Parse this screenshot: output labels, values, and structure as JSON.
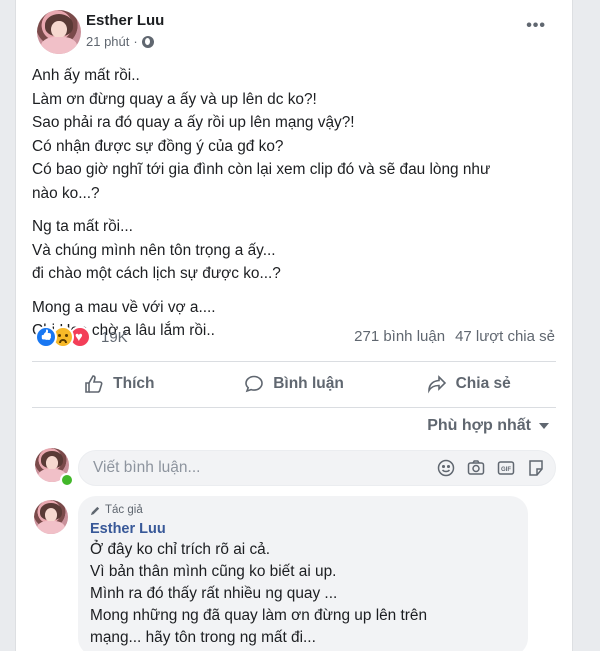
{
  "post": {
    "author": "Esther Luu",
    "time": "21 phút",
    "dot": "·",
    "more_label": "•••",
    "paragraphs": [
      [
        "Anh ấy mất rồi..",
        "Làm ơn đừng quay a ấy và up lên dc ko?!",
        "Sao phải ra đó quay a ấy rồi up lên mạng vậy?!",
        "Có nhận được sự đồng ý của gđ ko?",
        "Có bao giờ nghĩ tới gia đình còn lại xem clip đó và sẽ đau lòng như",
        "nào ko...?"
      ],
      [
        "Ng ta mất rồi...",
        "Và chúng mình nên tôn trọng a ấy...",
        "đi chào một cách lịch sự được ko...?"
      ],
      [
        "Mong a mau về với vợ a....",
        "Chị Heo chờ a lâu lắm rồi.."
      ]
    ]
  },
  "stats": {
    "reaction_count": "19K",
    "comments": "271 bình luận",
    "shares": "47 lượt chia sẻ"
  },
  "actions": {
    "like": "Thích",
    "comment": "Bình luận",
    "share": "Chia sẻ"
  },
  "sort": {
    "label": "Phù hợp nhất"
  },
  "composer": {
    "placeholder": "Viết bình luận..."
  },
  "comment": {
    "badge": "Tác giả",
    "author": "Esther Luu",
    "lines": [
      "Ở đây ko chỉ trích rõ ai cả.",
      "Vì bản thân mình cũng ko biết ai up.",
      "Mình ra đó thấy rất nhiều ng quay ...",
      "Mong những ng đã quay làm ơn đừng up lên trên",
      "mạng... hãy tôn trong ng mất đi..."
    ]
  },
  "colors": {
    "like_blue": "#1877f2",
    "sad_yellow": "#f7b928",
    "love_red": "#f33e58",
    "online_green": "#42b72a",
    "author_link": "#385898"
  },
  "icons": {
    "reactions": [
      "like-reaction-icon",
      "sad-reaction-icon",
      "love-reaction-icon"
    ],
    "composer": [
      "emoji-icon",
      "camera-icon",
      "gif-icon",
      "sticker-icon"
    ]
  }
}
